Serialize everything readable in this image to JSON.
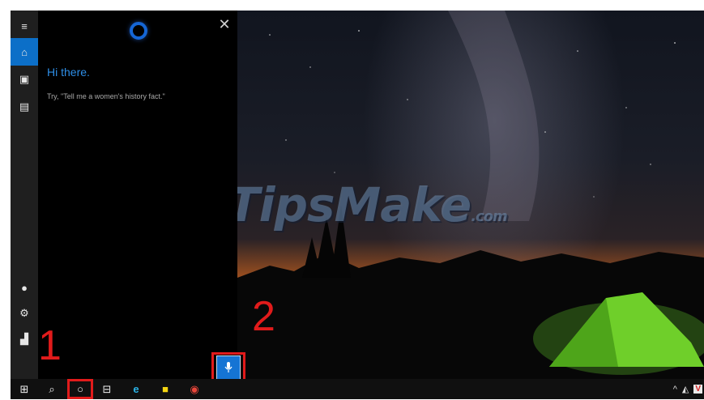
{
  "cortana": {
    "greeting": "Hi there.",
    "suggestion": "Try, \"Tell me a women's history fact.\"",
    "close_glyph": "✕"
  },
  "rail": {
    "items": [
      {
        "name": "menu-icon",
        "glyph": "≡"
      },
      {
        "name": "home-icon",
        "glyph": "⌂",
        "active": true
      },
      {
        "name": "notebook-icon",
        "glyph": "▣"
      },
      {
        "name": "collections-icon",
        "glyph": "▤"
      },
      {
        "name": "avatar-icon",
        "glyph": "●"
      },
      {
        "name": "settings-icon",
        "glyph": "⚙"
      },
      {
        "name": "feedback-icon",
        "glyph": "▟"
      }
    ]
  },
  "annotations": {
    "step1": "1",
    "step2": "2",
    "color": "#e11b1b"
  },
  "watermark": {
    "brand": "TipsMake",
    "tld": ".com"
  },
  "taskbar": {
    "items": [
      {
        "name": "start-icon",
        "glyph": "⊞"
      },
      {
        "name": "search-icon",
        "glyph": "⌕"
      },
      {
        "name": "cortana-icon",
        "glyph": "○"
      },
      {
        "name": "task-view-icon",
        "glyph": "⊟"
      },
      {
        "name": "edge-icon",
        "glyph": "e"
      },
      {
        "name": "sticky-notes-icon",
        "glyph": "■"
      },
      {
        "name": "chrome-icon",
        "glyph": "◉"
      }
    ],
    "tray": {
      "chevron": "^",
      "network": "◭",
      "app_badge": "V"
    }
  },
  "colors": {
    "accent": "#0c6fc8",
    "greeting": "#2e8ee6",
    "cortana_ring": "#1566d6"
  }
}
